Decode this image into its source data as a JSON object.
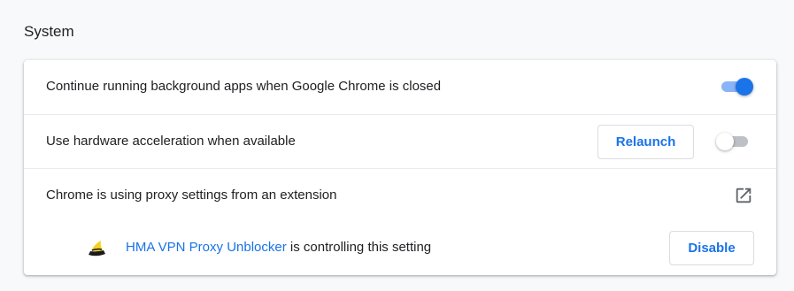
{
  "section": {
    "title": "System"
  },
  "rows": [
    {
      "label": "Continue running background apps when Google Chrome is closed",
      "toggle": "on"
    },
    {
      "label": "Use hardware acceleration when available",
      "button": "Relaunch",
      "toggle": "off"
    },
    {
      "label": "Chrome is using proxy settings from an extension",
      "icon": "open-in-new-icon"
    }
  ],
  "extension": {
    "icon": "hma-hat-icon",
    "name": "HMA VPN Proxy Unblocker",
    "suffix": " is controlling this setting",
    "button": "Disable"
  },
  "colors": {
    "accent": "#1a73e8",
    "toggle_on_track": "#8ab4f8",
    "toggle_off_track": "#bdc1c6",
    "page_bg": "#f8f9fa",
    "card_bg": "#ffffff"
  }
}
